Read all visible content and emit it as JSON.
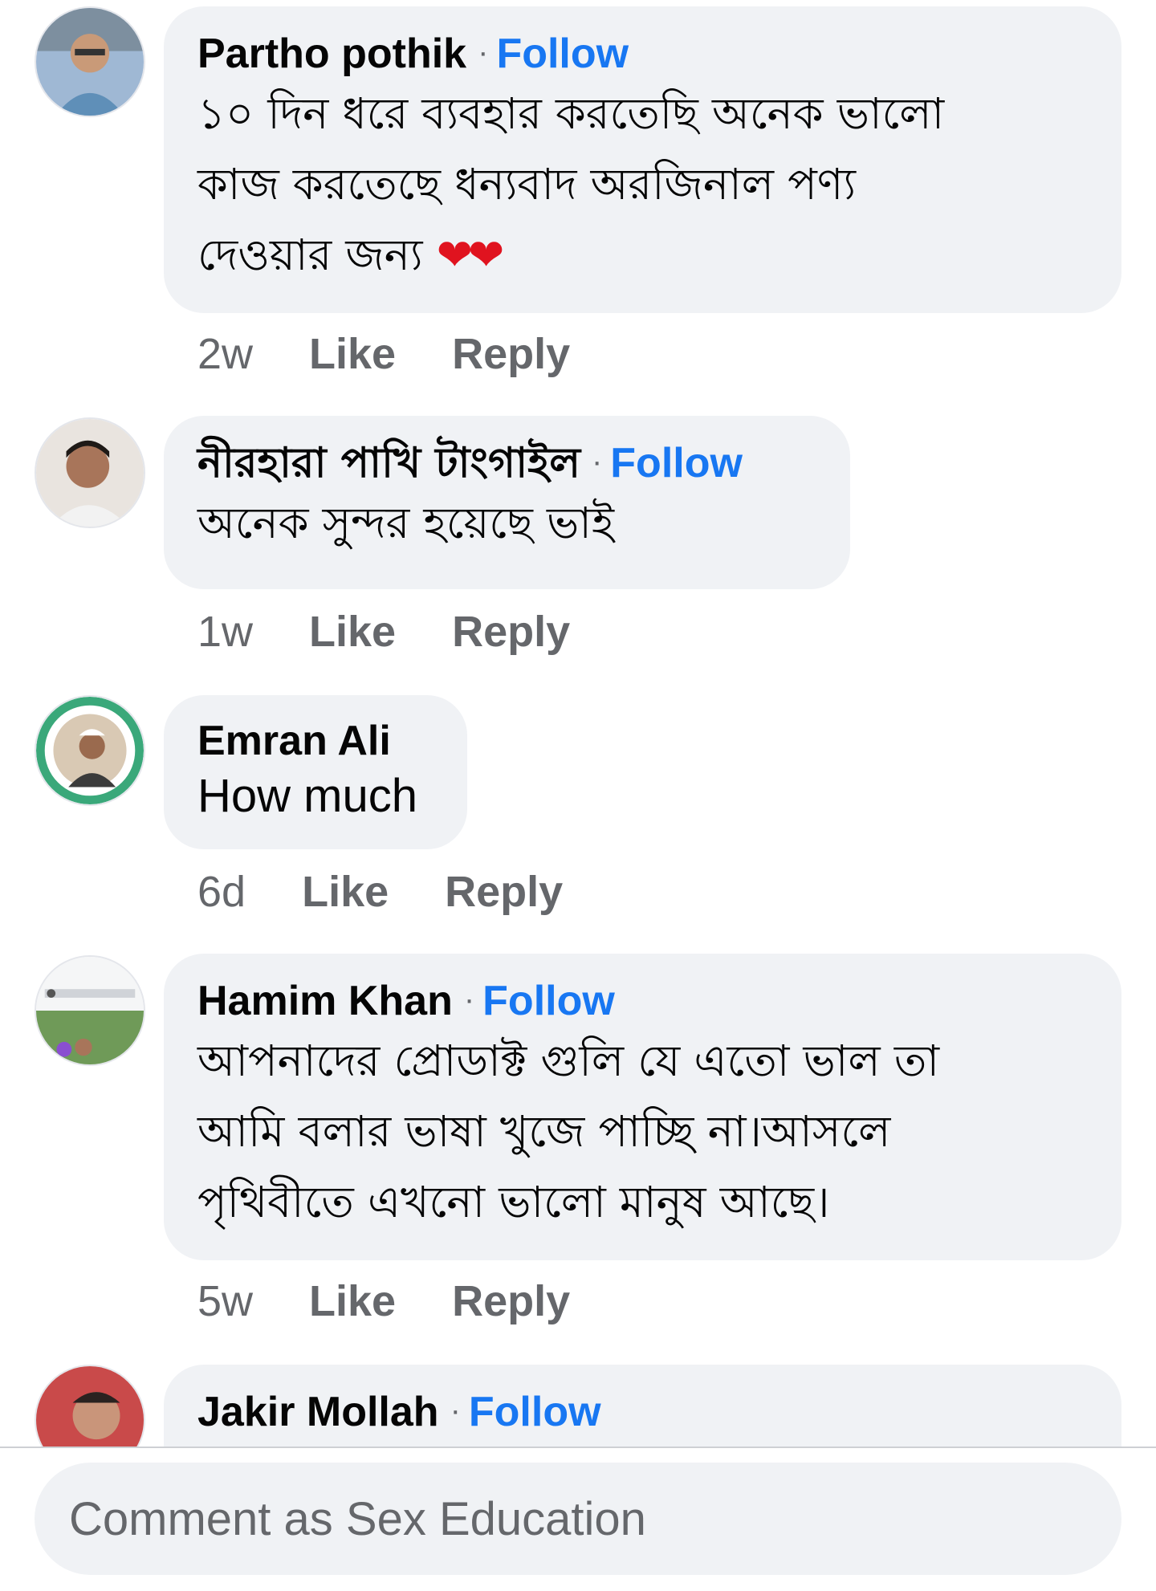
{
  "comments": [
    {
      "name": "Partho pothik",
      "follow": "Follow",
      "lines": [
        "১০ দিন ধরে ব্যবহার করতেছি অনেক ভালো",
        "কাজ করতেছে ধন্যবাদ অরজিনাল পণ্য",
        "দেওয়ার জন্য"
      ],
      "emoji": "❤❤",
      "time": "2w",
      "like": "Like",
      "reply": "Reply"
    },
    {
      "name": "নীরহারা পাখি টাংগাইল",
      "follow": "Follow",
      "lines": [
        "অনেক সুন্দর হয়েছে ভাই"
      ],
      "time": "1w",
      "like": "Like",
      "reply": "Reply"
    },
    {
      "name": "Emran Ali",
      "lines": [
        "How much"
      ],
      "time": "6d",
      "like": "Like",
      "reply": "Reply"
    },
    {
      "name": "Hamim Khan",
      "follow": "Follow",
      "lines": [
        "আপনাদের প্রোডাক্ট গুলি যে এতো ভাল তা",
        "আমি বলার ভাষা খুজে পাচ্ছি না।আসলে",
        "পৃথিবীতে এখনো ভালো মানুষ আছে।"
      ],
      "time": "5w",
      "like": "Like",
      "reply": "Reply"
    },
    {
      "name": "Jakir Mollah",
      "follow": "Follow"
    }
  ],
  "composer": {
    "placeholder": "Comment as Sex Education"
  },
  "colors": {
    "follow": "#1877f2",
    "bubble": "#f0f2f5",
    "meta": "#65676b",
    "heart": "#e0131f"
  },
  "icons": [
    "avatar",
    "heart-emoji"
  ]
}
